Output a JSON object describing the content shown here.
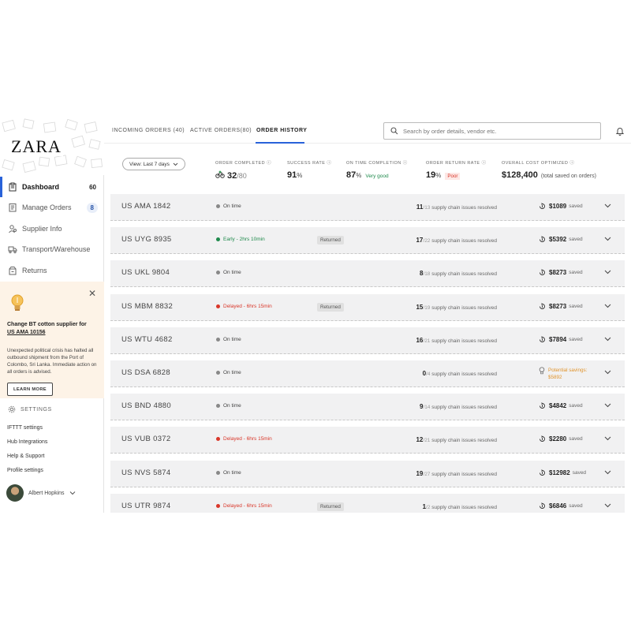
{
  "brand": {
    "logo_text": "ZARA"
  },
  "sidebar": {
    "items": [
      {
        "label": "Dashboard",
        "icon": "dashboard-icon",
        "count": "60"
      },
      {
        "label": "Manage Orders",
        "icon": "orders-icon",
        "count": "8"
      },
      {
        "label": "Supplier Info",
        "icon": "supplier-icon"
      },
      {
        "label": "Transport/Warehouse",
        "icon": "truck-icon"
      },
      {
        "label": "Returns",
        "icon": "returns-icon"
      }
    ],
    "alert": {
      "title": "Change BT cotton supplier for",
      "link": "US AMA 10156",
      "body": "Unexpected political crisis has halted all outbound shipment from the Port of Colombo, Sri Lanka. Immediate action on all orders is advised.",
      "button": "LEARN MORE"
    },
    "settings": {
      "heading": "SETTINGS",
      "links": [
        "IFTTT settings",
        "Hub Integrations",
        "Help & Support",
        "Profile settings"
      ]
    },
    "user": {
      "name": "Albert Hopkins"
    }
  },
  "header": {
    "tabs": [
      "INCOMING ORDERS (40)",
      "ACTIVE ORDERS(80)",
      "ORDER HISTORY"
    ],
    "active_tab": "ORDER HISTORY",
    "search_placeholder": "Search by order details, vendor etc."
  },
  "stats": {
    "view": "View: Last 7 days",
    "order_completed": {
      "label": "ORDER COMPLETED",
      "value": "32",
      "total": "/80"
    },
    "success_rate": {
      "label": "SUCCESS RATE",
      "value": "91",
      "unit": "%"
    },
    "on_time": {
      "label": "ON TIME COMPLETION",
      "value": "87",
      "unit": "%",
      "tag": "Very good"
    },
    "return_rate": {
      "label": "ORDER RETURN RATE",
      "value": "19",
      "unit": "%",
      "tag": "Poor"
    },
    "cost": {
      "label": "OVERALL COST OPTIMIZED",
      "value": "$128,400",
      "note": "(total saved on orders)"
    }
  },
  "issues_suffix": "supply chain issues resolved",
  "saved_suffix": "saved",
  "orders": [
    {
      "id": "US AMA 1842",
      "status": "On time",
      "kind": "ontime",
      "returned": "",
      "resolved": "11",
      "total": "/13",
      "amount": "$1089"
    },
    {
      "id": "US UYG 8935",
      "status": "Early - 2hrs 10min",
      "kind": "early",
      "returned": "Returned",
      "resolved": "17",
      "total": "/22",
      "amount": "$5392"
    },
    {
      "id": "US UKL 9804",
      "status": "On time",
      "kind": "ontime",
      "returned": "",
      "resolved": "8",
      "total": "/18",
      "amount": "$8273"
    },
    {
      "id": "US MBM 8832",
      "status": "Delayed - 6hrs 15min",
      "kind": "delayed",
      "returned": "Returned",
      "resolved": "15",
      "total": "/19",
      "amount": "$8273"
    },
    {
      "id": "US WTU 4682",
      "status": "On time",
      "kind": "ontime",
      "returned": "",
      "resolved": "16",
      "total": "/21",
      "amount": "$7894"
    },
    {
      "id": "US DSA 6828",
      "status": "On time",
      "kind": "ontime",
      "returned": "",
      "resolved": "0",
      "total": "/4",
      "potential": "Potential savings:",
      "potential_amount": "$5892"
    },
    {
      "id": "US BND 4880",
      "status": "On time",
      "kind": "ontime",
      "returned": "",
      "resolved": "9",
      "total": "/14",
      "amount": "$4842"
    },
    {
      "id": "US VUB 0372",
      "status": "Delayed - 6hrs 15min",
      "kind": "delayed",
      "returned": "",
      "resolved": "12",
      "total": "/21",
      "amount": "$2280"
    },
    {
      "id": "US NVS 5874",
      "status": "On time",
      "kind": "ontime",
      "returned": "",
      "resolved": "19",
      "total": "/27",
      "amount": "$12982"
    },
    {
      "id": "US UTR 9874",
      "status": "Delayed - 6hrs 15min",
      "kind": "delayed",
      "returned": "Returned",
      "resolved": "1",
      "total": "/2",
      "amount": "$6846"
    }
  ],
  "colors": {
    "accent": "#2962d9",
    "good": "#1f8a4c",
    "bad": "#d9372a",
    "potential": "#e0932b",
    "alert_bg": "#fdf3e7",
    "row_bg": "#f1f1f2"
  }
}
